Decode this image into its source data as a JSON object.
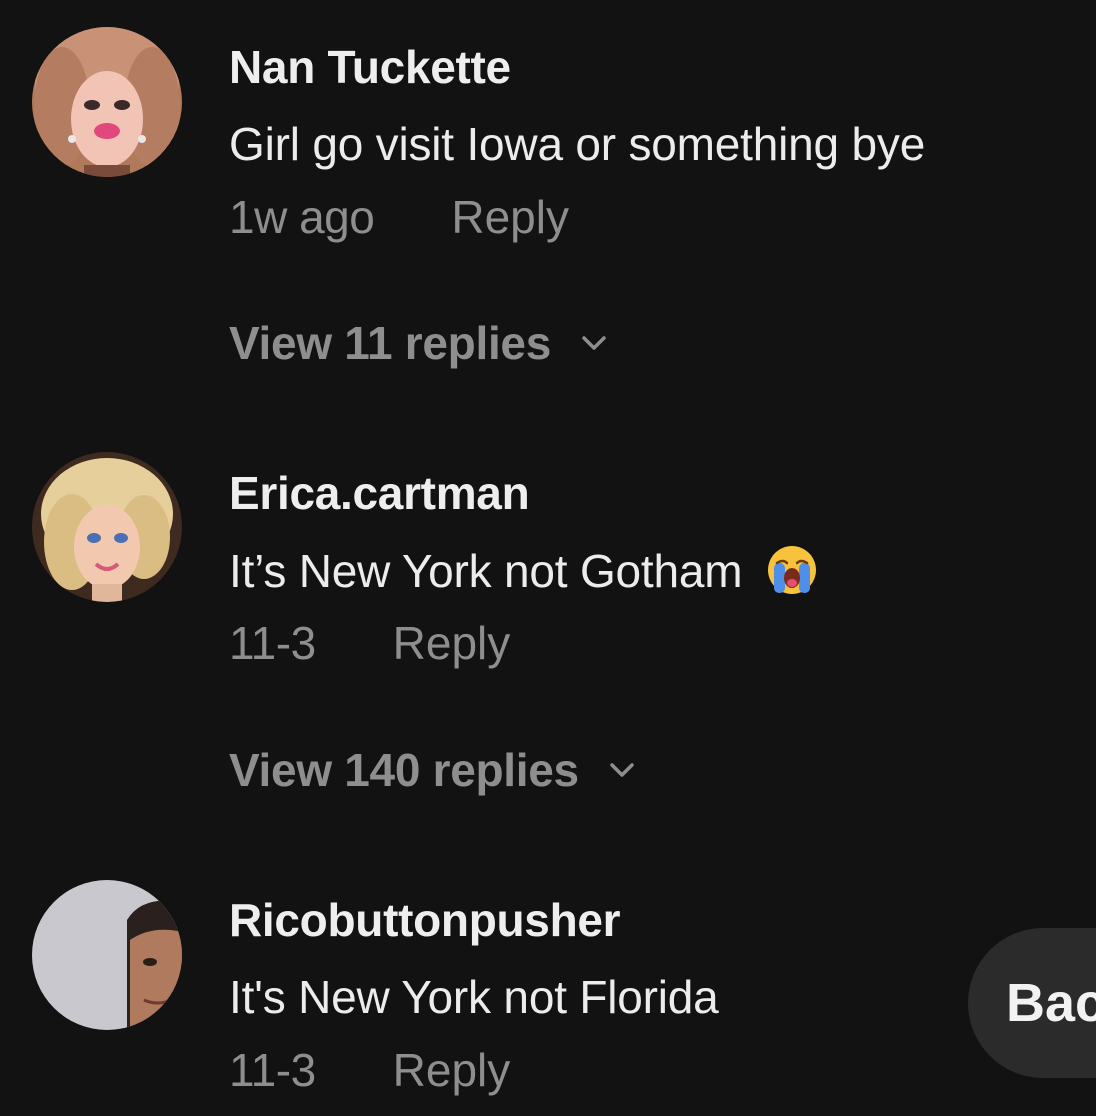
{
  "comments": [
    {
      "username": "Nan Tuckette",
      "text": "Girl go visit Iowa or something bye",
      "time": "1w ago",
      "reply_label": "Reply",
      "view_replies_label": "View 11 replies"
    },
    {
      "username": "Erica.cartman",
      "text": "It’s New York not Gotham",
      "emoji": "crying-face-emoji",
      "time": "11-3",
      "reply_label": "Reply",
      "view_replies_label": "View 140 replies"
    },
    {
      "username": "Ricobuttonpusher",
      "text": "It's New York not Florida",
      "time": "11-3",
      "reply_label": "Reply"
    }
  ],
  "back_button": {
    "label": "Back"
  },
  "icons": {
    "expand": "chevron-down-icon",
    "emoji": "loudly-crying-face-icon"
  },
  "colors": {
    "background": "#121212",
    "primary_text": "#eeeeee",
    "secondary_text": "#8e8e8e",
    "pill": "#2b2b2b"
  }
}
